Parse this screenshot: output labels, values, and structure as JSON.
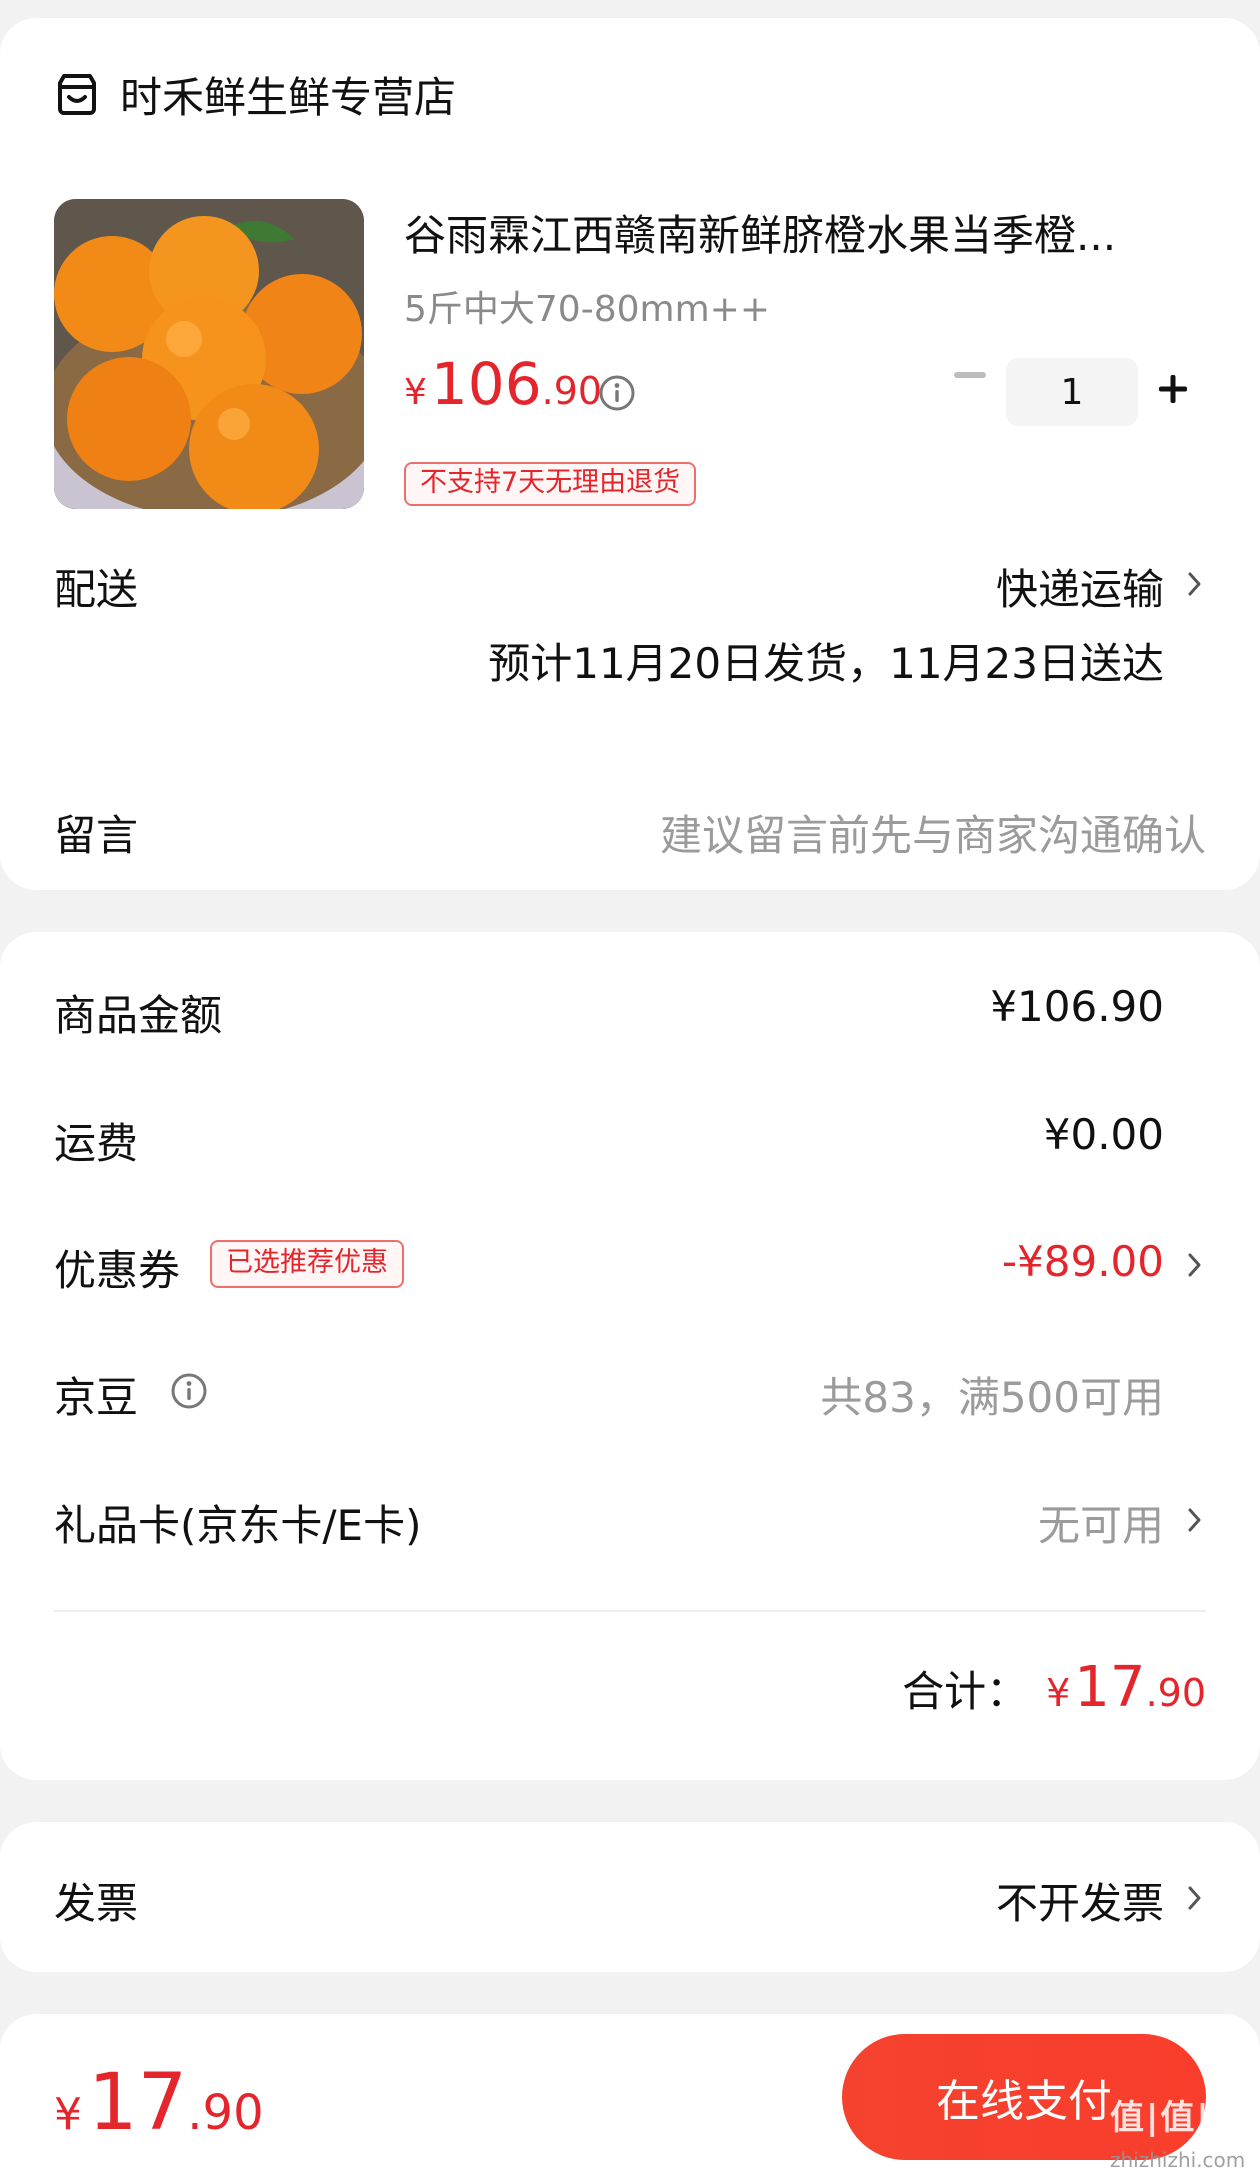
{
  "store": {
    "name": "时禾鲜生鲜专营店",
    "icon": "store-icon"
  },
  "product": {
    "title": "谷雨霖江西赣南新鲜脐橙水果当季橙...",
    "spec": "5斤中大70-80mm++",
    "price_symbol": "¥",
    "price_int": "106",
    "price_dec": ".90",
    "quantity": "1",
    "return_tag": "不支持7天无理由退货",
    "image": "oranges-product-photo"
  },
  "delivery": {
    "label": "配送",
    "method": "快递运输",
    "estimate": "预计11月20日发货，11月23日送达"
  },
  "message": {
    "label": "留言",
    "placeholder": "建议留言前先与商家沟通确认"
  },
  "summary": {
    "goods_label": "商品金额",
    "goods_value": "¥106.90",
    "shipping_label": "运费",
    "shipping_value": "¥0.00",
    "coupon_label": "优惠券",
    "coupon_tag": "已选推荐优惠",
    "coupon_value": "-¥89.00",
    "beans_label": "京豆",
    "beans_value": "共83，满500可用",
    "giftcard_label": "礼品卡(京东卡/E卡)",
    "giftcard_value": "无可用",
    "total_label": "合计：",
    "total_symbol": "¥",
    "total_int": "17",
    "total_dec": ".90"
  },
  "invoice": {
    "label": "发票",
    "value": "不开发票"
  },
  "footer": {
    "price_symbol": "¥",
    "price_int": "17",
    "price_dec": ".90",
    "pay_label": "在线支付",
    "watermark": "值|值|值",
    "watermark_sub": "zhizhizhi.com"
  },
  "colors": {
    "accent": "#e4262c",
    "button": "#f5422e"
  }
}
